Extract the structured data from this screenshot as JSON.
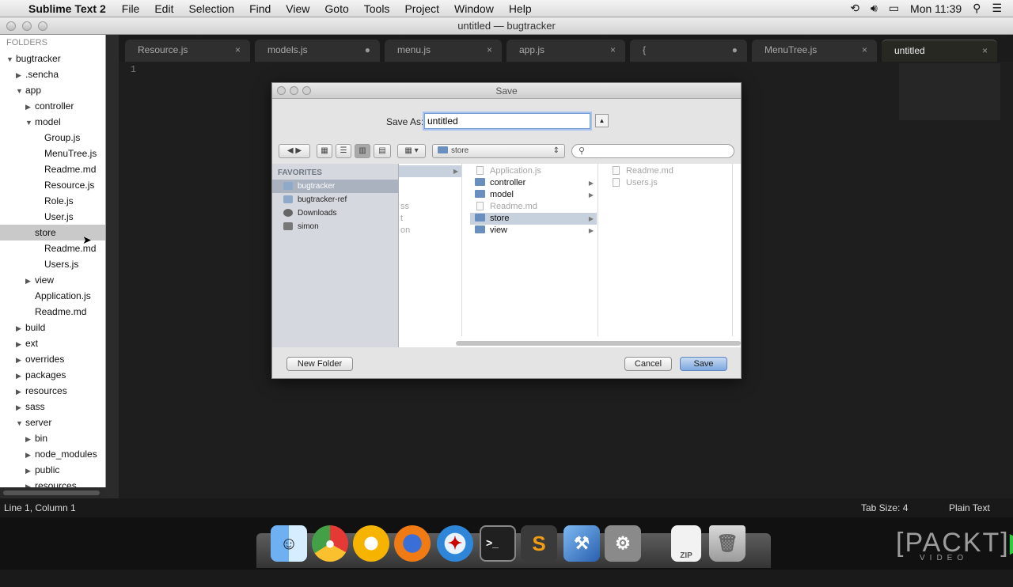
{
  "menubar": {
    "app_name": "Sublime Text 2",
    "items": [
      "File",
      "Edit",
      "Selection",
      "Find",
      "View",
      "Goto",
      "Tools",
      "Project",
      "Window",
      "Help"
    ],
    "clock": "Mon 11:39"
  },
  "window": {
    "title": "untitled — bugtracker"
  },
  "sidebar": {
    "header": "FOLDERS",
    "rows": [
      {
        "label": "bugtracker",
        "arrow": "▼"
      },
      {
        "label": ".sencha",
        "arrow": "▶"
      },
      {
        "label": "app",
        "arrow": "▼"
      },
      {
        "label": "controller",
        "arrow": "▶"
      },
      {
        "label": "model",
        "arrow": "▼"
      },
      {
        "label": "Group.js",
        "arrow": ""
      },
      {
        "label": "MenuTree.js",
        "arrow": ""
      },
      {
        "label": "Readme.md",
        "arrow": ""
      },
      {
        "label": "Resource.js",
        "arrow": ""
      },
      {
        "label": "Role.js",
        "arrow": ""
      },
      {
        "label": "User.js",
        "arrow": ""
      },
      {
        "label": "store",
        "arrow": ""
      },
      {
        "label": "Readme.md",
        "arrow": ""
      },
      {
        "label": "Users.js",
        "arrow": ""
      },
      {
        "label": "view",
        "arrow": "▶"
      },
      {
        "label": "Application.js",
        "arrow": ""
      },
      {
        "label": "Readme.md",
        "arrow": ""
      },
      {
        "label": "build",
        "arrow": "▶"
      },
      {
        "label": "ext",
        "arrow": "▶"
      },
      {
        "label": "overrides",
        "arrow": "▶"
      },
      {
        "label": "packages",
        "arrow": "▶"
      },
      {
        "label": "resources",
        "arrow": "▶"
      },
      {
        "label": "sass",
        "arrow": "▶"
      },
      {
        "label": "server",
        "arrow": "▼"
      },
      {
        "label": "bin",
        "arrow": "▶"
      },
      {
        "label": "node_modules",
        "arrow": "▶"
      },
      {
        "label": "public",
        "arrow": "▶"
      },
      {
        "label": "resources",
        "arrow": "▶"
      }
    ]
  },
  "tabs": [
    {
      "label": "Resource.js",
      "mark": "×"
    },
    {
      "label": "models.js",
      "mark": "●"
    },
    {
      "label": "menu.js",
      "mark": "×"
    },
    {
      "label": "app.js",
      "mark": "×"
    },
    {
      "label": "{",
      "mark": "●"
    },
    {
      "label": "MenuTree.js",
      "mark": "×"
    },
    {
      "label": "untitled",
      "mark": "×"
    }
  ],
  "editor": {
    "line_number": "1"
  },
  "statusbar": {
    "position": "Line 1, Column 1",
    "tab_size": "Tab Size: 4",
    "syntax": "Plain Text"
  },
  "dialog": {
    "title": "Save",
    "save_as_label": "Save As:",
    "filename": "untitled",
    "location": "store",
    "favorites_header": "FAVORITES",
    "favorites": [
      "bugtracker",
      "bugtracker-ref",
      "Downloads",
      "simon"
    ],
    "col1_partial": [
      "ss",
      "t",
      "on"
    ],
    "col2": [
      {
        "label": "Application.js",
        "kind": "doc",
        "dim": true
      },
      {
        "label": "controller",
        "kind": "folder",
        "dim": false
      },
      {
        "label": "model",
        "kind": "folder",
        "dim": false
      },
      {
        "label": "Readme.md",
        "kind": "doc",
        "dim": true
      },
      {
        "label": "store",
        "kind": "folder",
        "dim": false
      },
      {
        "label": "view",
        "kind": "folder",
        "dim": false
      }
    ],
    "col3": [
      {
        "label": "Readme.md",
        "dim": true
      },
      {
        "label": "Users.js",
        "dim": true
      }
    ],
    "new_folder": "New Folder",
    "cancel": "Cancel",
    "save": "Save"
  },
  "dock": {
    "icons": [
      "finder",
      "chrome",
      "chromium",
      "firefox",
      "safari",
      "terminal",
      "sublime-text",
      "xcode",
      "system-preferences",
      "archive",
      "trash"
    ],
    "watermark": "[PACKT]",
    "watermark_sub": "VIDEO"
  }
}
